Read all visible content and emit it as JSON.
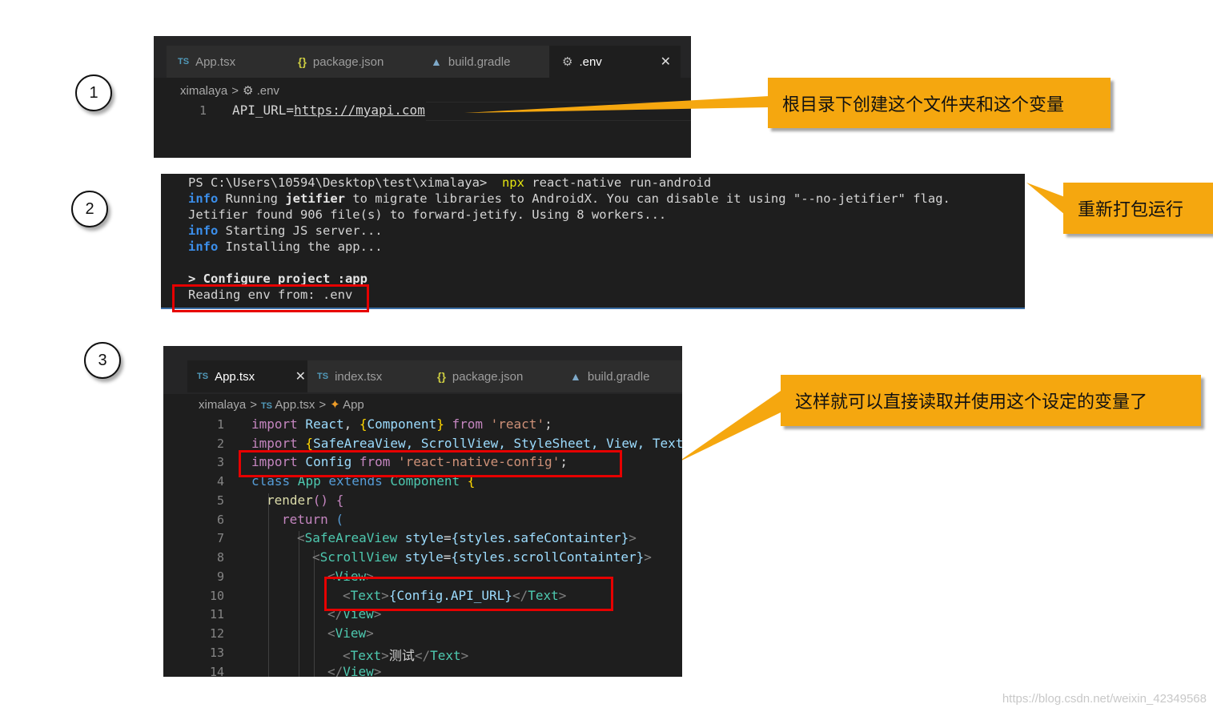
{
  "steps": [
    "1",
    "2",
    "3"
  ],
  "panel1": {
    "tabs": [
      {
        "icon": "TS",
        "label": "App.tsx"
      },
      {
        "icon": "{}",
        "label": "package.json"
      },
      {
        "icon": "gradle",
        "label": "build.gradle"
      },
      {
        "icon": "gear",
        "label": ".env",
        "active": true
      }
    ],
    "breadcrumb": [
      "ximalaya",
      ".env"
    ],
    "line_number": "1",
    "code_key": "API_URL=",
    "code_value": "https://myapi.com"
  },
  "panel2": {
    "prompt": "PS C:\\Users\\10594\\Desktop\\test\\ximalaya> ",
    "command_npx": "npx",
    "command_rest": " react-native run-android",
    "line2_info": "info",
    "line2_a": " Running ",
    "line2_bold": "jetifier",
    "line2_b": " to migrate libraries to AndroidX. You can disable it using \"--no-jetifier\" flag.",
    "line3": "Jetifier found 906 file(s) to forward-jetify. Using 8 workers...",
    "line4_info": "info",
    "line4": " Starting JS server...",
    "line5_info": "info",
    "line5": " Installing the app...",
    "line6": "> Configure project :app",
    "line7": "Reading env from: .env"
  },
  "panel3": {
    "tabs": [
      {
        "icon": "TS",
        "label": "App.tsx",
        "active": true
      },
      {
        "icon": "TS",
        "label": "index.tsx"
      },
      {
        "icon": "{}",
        "label": "package.json"
      },
      {
        "icon": "gradle",
        "label": "build.gradle"
      }
    ],
    "breadcrumb": [
      "ximalaya",
      "App.tsx",
      "App"
    ],
    "line_numbers": [
      "1",
      "2",
      "3",
      "4",
      "5",
      "6",
      "7",
      "8",
      "9",
      "10",
      "11",
      "12",
      "13",
      "14"
    ],
    "code": {
      "l1_import": "import",
      "l1_react": " React",
      "l1_comma": ", ",
      "l1_ob": "{",
      "l1_component": "Component",
      "l1_cb": "}",
      "l1_from": " from ",
      "l1_str": "'react'",
      "l1_end": ";",
      "l2_import": "import",
      "l2_ob": " {",
      "l2_items": "SafeAreaView, ScrollView, StyleSheet, View, Text",
      "l3_import": "import",
      "l3_config": " Config",
      "l3_from": " from ",
      "l3_str": "'react-native-config'",
      "l3_end": ";",
      "l4_class": "class",
      "l4_app": " App",
      "l4_extends": " extends",
      "l4_component": " Component",
      "l4_brace": " {",
      "l5_render": "render",
      "l5_paren": "() {",
      "l6_return": "return",
      "l6_paren": " (",
      "l7_tag": "SafeAreaView",
      "l7_attr": " style",
      "l7_val": "{styles.safeContainter}",
      "l8_tag": "ScrollView",
      "l8_attr": " style",
      "l8_val": "{styles.scrollContainter}",
      "l9_tag": "View",
      "l10_tag": "Text",
      "l10_val": "{Config.API_URL}",
      "l10_close": "Text",
      "l11_tag": "View",
      "l12_tag": "View",
      "l13_tag": "Text",
      "l13_text": "测试",
      "l13_close": "Text",
      "l14_tag": "View"
    }
  },
  "callouts": {
    "c1": "根目录下创建这个文件夹和这个变量",
    "c2": "重新打包运行",
    "c3": "这样就可以直接读取并使用这个设定的变量了"
  },
  "watermark": "https://blog.csdn.net/weixin_42349568",
  "colors": {
    "callout": "#f5a70f",
    "highlight_box": "#e60000",
    "editor_bg": "#1e1e1e"
  }
}
